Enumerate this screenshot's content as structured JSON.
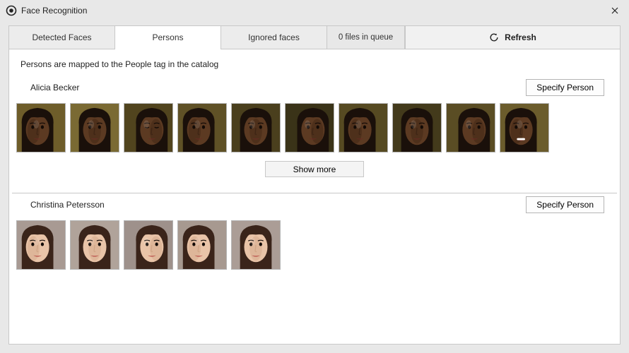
{
  "window": {
    "title": "Face Recognition"
  },
  "tabs": {
    "detected": "Detected Faces",
    "persons": "Persons",
    "ignored": "Ignored faces"
  },
  "queue": {
    "text": "0 files in queue"
  },
  "refresh": {
    "label": "Refresh"
  },
  "hint": "Persons are mapped to the People tag in the catalog",
  "buttons": {
    "specify": "Specify Person",
    "show_more": "Show more"
  },
  "persons": [
    {
      "name": "Alicia Becker",
      "thumb_count": 10,
      "has_more": true
    },
    {
      "name": "Christina Petersson",
      "thumb_count": 5,
      "has_more": false
    }
  ]
}
